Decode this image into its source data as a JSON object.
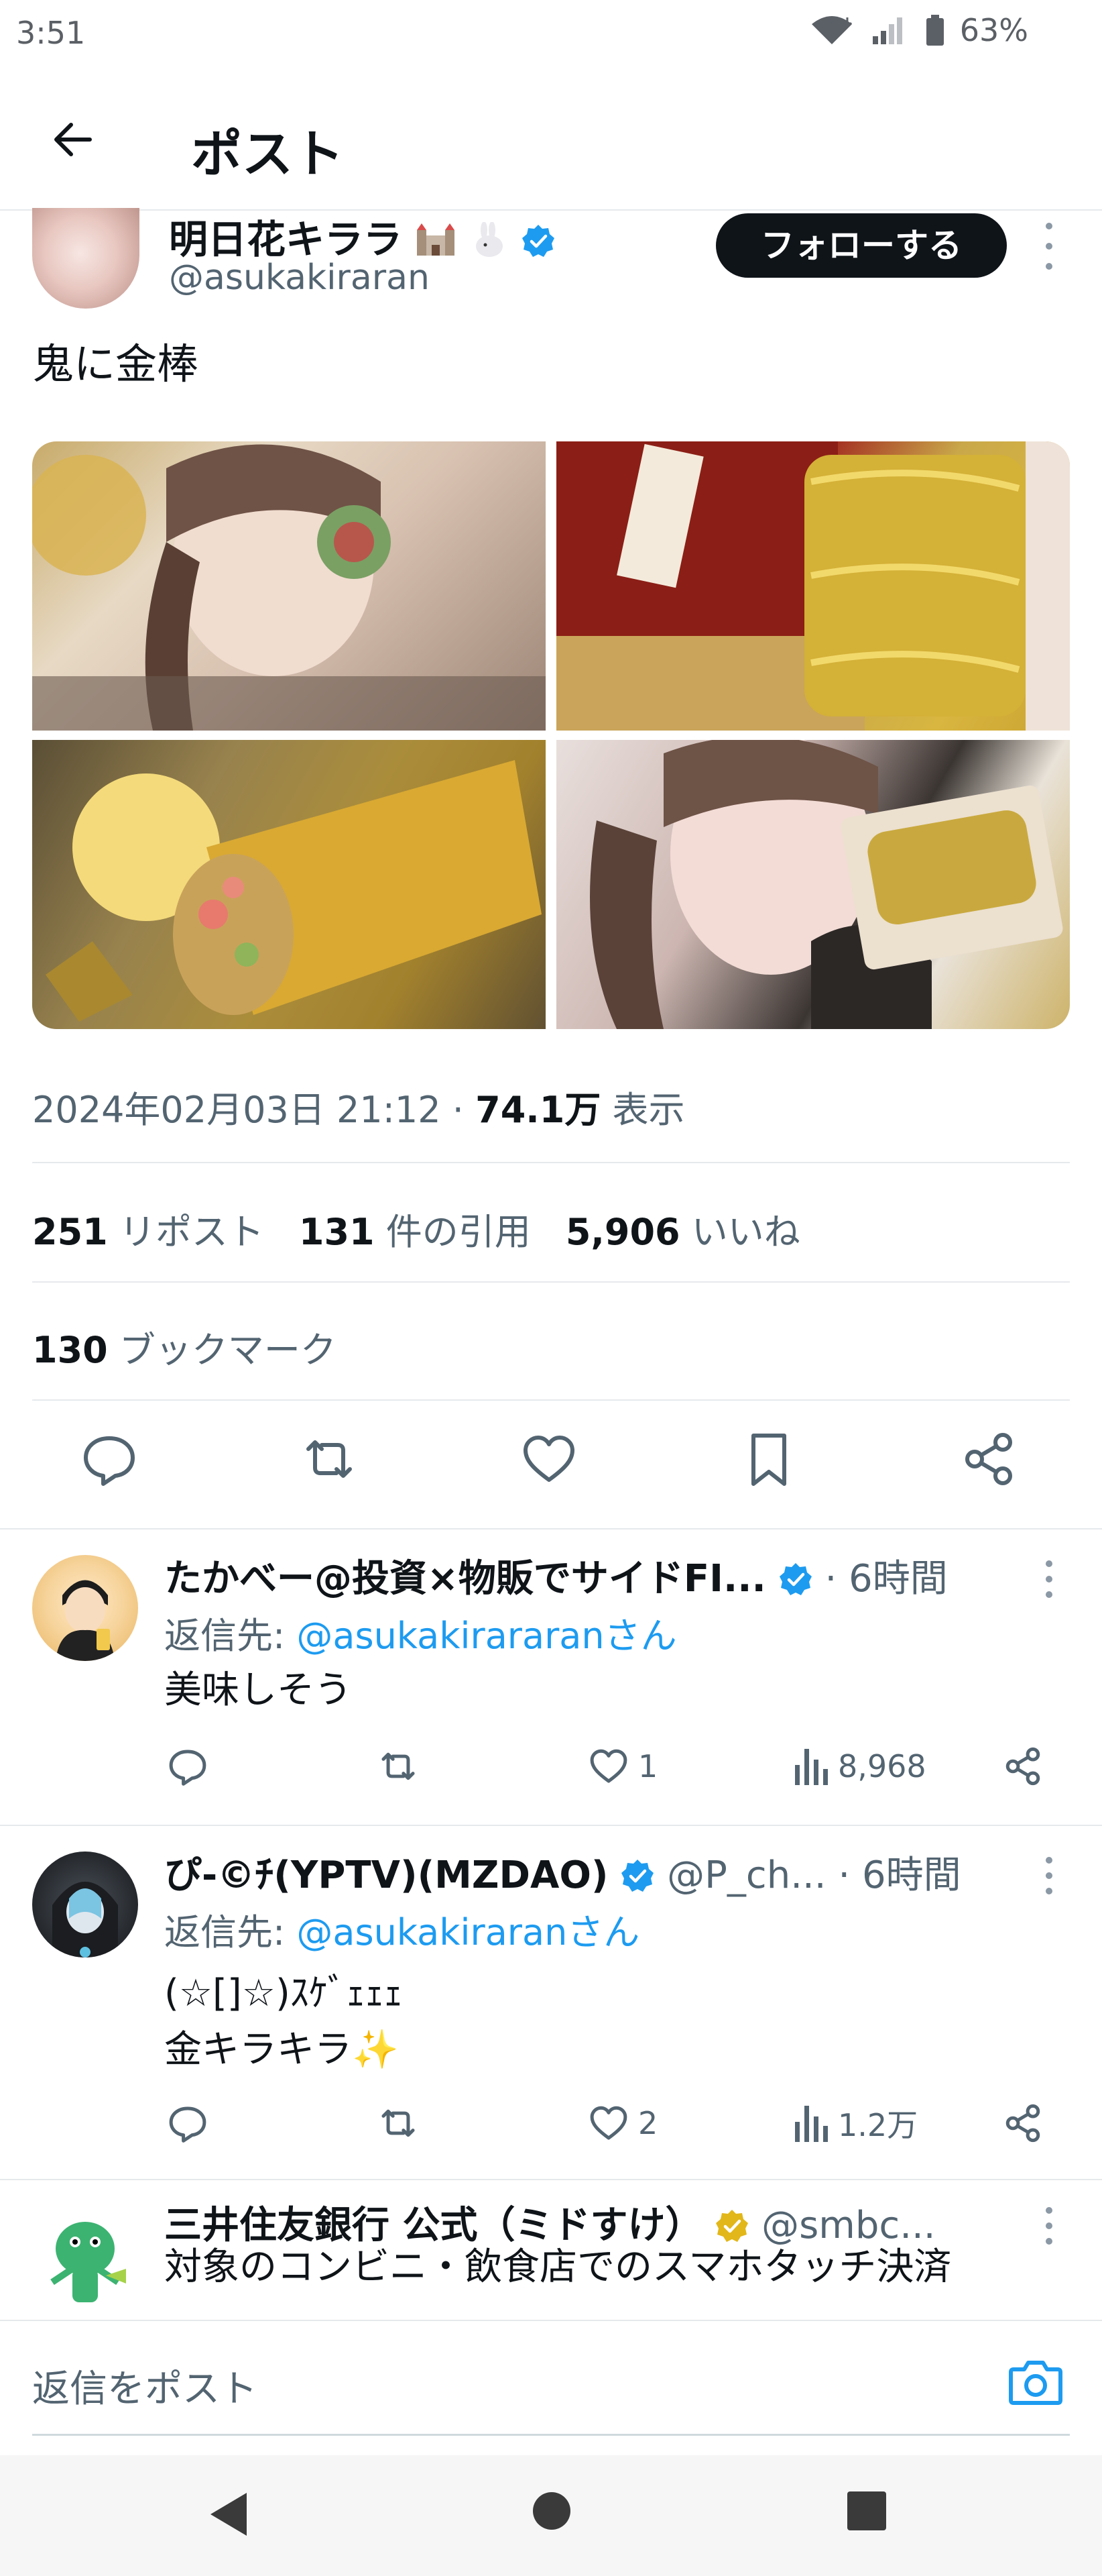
{
  "status_bar": {
    "time": "3:51",
    "battery": "63%"
  },
  "header": {
    "title": "ポスト"
  },
  "post": {
    "author_name": "明日花キララ",
    "handle": "@asukakiraran",
    "follow_label": "フォローする",
    "text": "鬼に金棒",
    "datetime": "2024年02月03日 21:12",
    "sep": " · ",
    "views_count": "74.1万",
    "views_label": " 表示",
    "reposts_count": "251",
    "reposts_label": " リポスト",
    "quotes_count": "131",
    "quotes_label": " 件の引用",
    "likes_count": "5,906",
    "likes_label": " いいね",
    "bookmarks_count": "130",
    "bookmarks_label": " ブックマーク"
  },
  "replies": [
    {
      "name": "たかべー@投資×物販でサイドFI...",
      "handle": "",
      "time": "· 6時間",
      "replying_prefix": "返信先: ",
      "replying_to": "@asukakirararanさん",
      "body": "美味しそう",
      "likes": "1",
      "views": "8,968"
    },
    {
      "name": "ぴ-©ﾁ(YPTV)(MZDAO)",
      "handle": "@P_ch...",
      "time": "· 6時間",
      "replying_prefix": "返信先: ",
      "replying_to": "@asukakiraranさん",
      "body": "(☆[]☆)ｽｹﾞｪｪｪ\n金キラキラ✨",
      "likes": "2",
      "views": "1.2万"
    },
    {
      "name": "三井住友銀行 公式（ミドすけ）",
      "handle": "@smbc...",
      "body": "対象のコンビニ・飲食店でのスマホタッチ決済"
    }
  ],
  "compose": {
    "placeholder": "返信をポスト"
  },
  "colors": {
    "accent": "#1d9bf0",
    "text": "#0f1419",
    "muted": "#536471",
    "gold_badge": "#e2b719"
  }
}
